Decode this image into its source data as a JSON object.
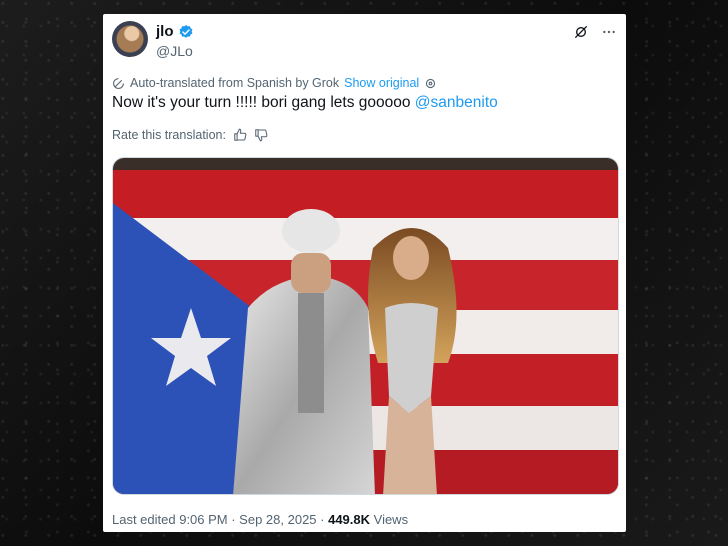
{
  "tweet": {
    "author_name": "jlo",
    "author_handle": "@JLo",
    "translation_notice": "Auto-translated from Spanish by Grok",
    "show_original_label": "Show original",
    "text_main": "Now it's your turn !!!!! bori gang lets gooooo",
    "mention": "@sanbenito",
    "rate_label": "Rate this translation:",
    "edited_label": "Last edited 9:06 PM · Sep 28, 2025 · ",
    "views_count": "449.8K",
    "views_label": " Views"
  },
  "icons": {
    "verified": "verified-badge-icon",
    "grok": "grok-icon",
    "more": "more-options-icon",
    "translate": "translate-icon",
    "info": "settings-icon",
    "thumb_up": "thumbs-up-icon",
    "thumb_down": "thumbs-down-icon"
  },
  "colors": {
    "link": "#1d9bf0",
    "text": "#0f1419",
    "secondary": "#536471"
  }
}
